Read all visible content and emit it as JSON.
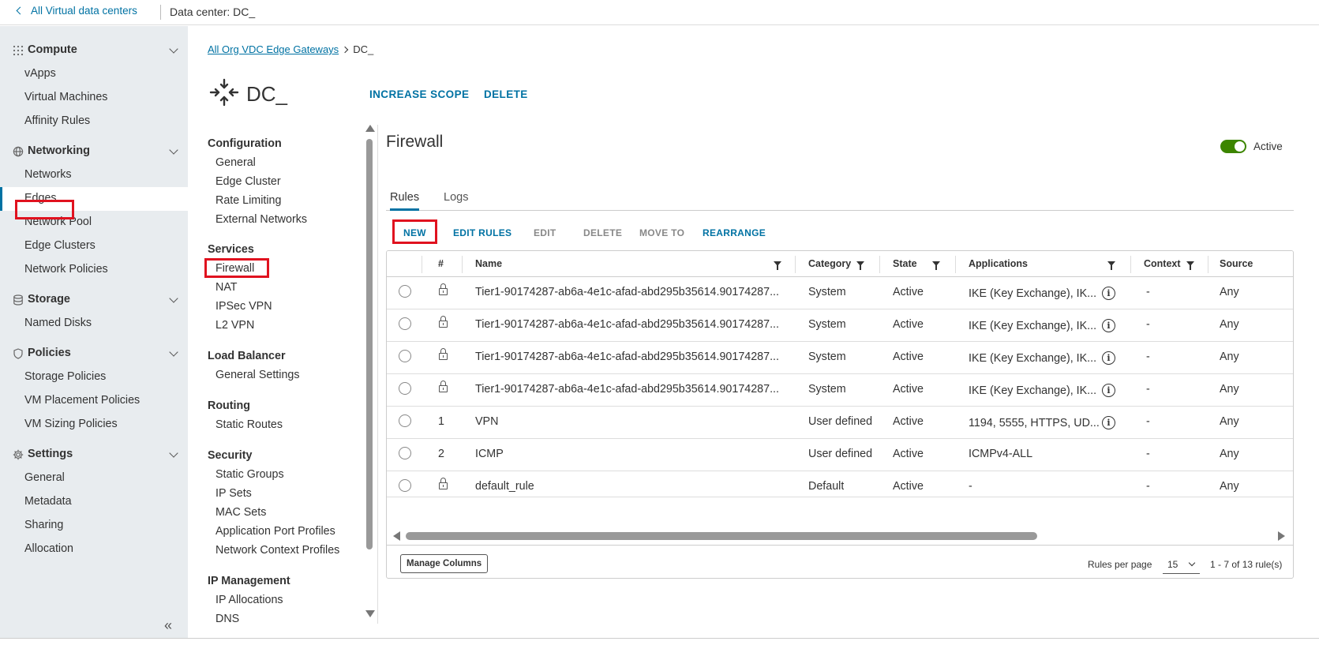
{
  "topbar": {
    "back_label": "All Virtual data centers",
    "dc_label": "Data center:",
    "dc_name": "DC_"
  },
  "sidebar": {
    "compute": {
      "label": "Compute",
      "items": [
        "vApps",
        "Virtual Machines",
        "Affinity Rules"
      ]
    },
    "networking": {
      "label": "Networking",
      "items": [
        "Networks",
        "Edges",
        "Network Pool",
        "Edge Clusters",
        "Network Policies"
      ]
    },
    "storage": {
      "label": "Storage",
      "items": [
        "Named Disks"
      ]
    },
    "policies": {
      "label": "Policies",
      "items": [
        "Storage Policies",
        "VM Placement Policies",
        "VM Sizing Policies"
      ]
    },
    "settings": {
      "label": "Settings",
      "items": [
        "General",
        "Metadata",
        "Sharing",
        "Allocation"
      ]
    },
    "collapse_glyph": "«"
  },
  "breadcrumb": {
    "parent": "All Org VDC Edge Gateways",
    "current": "DC_"
  },
  "gateway": {
    "name": "DC_",
    "actions": [
      "INCREASE SCOPE",
      "DELETE"
    ]
  },
  "leftnav": {
    "configuration": {
      "label": "Configuration",
      "items": [
        "General",
        "Edge Cluster",
        "Rate Limiting",
        "External Networks"
      ]
    },
    "services": {
      "label": "Services",
      "items": [
        "Firewall",
        "NAT",
        "IPSec VPN",
        "L2 VPN"
      ]
    },
    "load_balancer": {
      "label": "Load Balancer",
      "items": [
        "General Settings"
      ]
    },
    "routing": {
      "label": "Routing",
      "items": [
        "Static Routes"
      ]
    },
    "security": {
      "label": "Security",
      "items": [
        "Static Groups",
        "IP Sets",
        "MAC Sets",
        "Application Port Profiles",
        "Network Context Profiles"
      ]
    },
    "ip_management": {
      "label": "IP Management",
      "items": [
        "IP Allocations",
        "DNS"
      ]
    }
  },
  "firewall": {
    "title": "Firewall",
    "status_label": "Active",
    "tabs": [
      "Rules",
      "Logs"
    ],
    "toolbar": [
      "NEW",
      "EDIT RULES",
      "EDIT",
      "DELETE",
      "MOVE TO",
      "REARRANGE"
    ],
    "columns": [
      "#",
      "Name",
      "Category",
      "State",
      "Applications",
      "Context",
      "Source"
    ],
    "rows": [
      {
        "num": "",
        "name": "Tier1-90174287-ab6a-4e1c-afad-abd295b35614.90174287...",
        "category": "System",
        "state": "Active",
        "applications": "IKE (Key Exchange), IK...",
        "context": "-",
        "source": "Any"
      },
      {
        "num": "",
        "name": "Tier1-90174287-ab6a-4e1c-afad-abd295b35614.90174287...",
        "category": "System",
        "state": "Active",
        "applications": "IKE (Key Exchange), IK...",
        "context": "-",
        "source": "Any"
      },
      {
        "num": "",
        "name": "Tier1-90174287-ab6a-4e1c-afad-abd295b35614.90174287...",
        "category": "System",
        "state": "Active",
        "applications": "IKE (Key Exchange), IK...",
        "context": "-",
        "source": "Any"
      },
      {
        "num": "",
        "name": "Tier1-90174287-ab6a-4e1c-afad-abd295b35614.90174287...",
        "category": "System",
        "state": "Active",
        "applications": "IKE (Key Exchange), IK...",
        "context": "-",
        "source": "Any"
      },
      {
        "num": "1",
        "name": "VPN",
        "category": "User defined",
        "state": "Active",
        "applications": "1194, 5555, HTTPS, UD...",
        "context": "-",
        "source": "Any"
      },
      {
        "num": "2",
        "name": "ICMP",
        "category": "User defined",
        "state": "Active",
        "applications": "ICMPv4-ALL",
        "context": "-",
        "source": "Any"
      },
      {
        "num": "",
        "name": "default_rule",
        "category": "Default",
        "state": "Active",
        "applications": "-",
        "context": "-",
        "source": "Any"
      }
    ],
    "footer": {
      "manage_columns": "Manage Columns",
      "rows_per_page_label": "Rules per page",
      "rows_per_page": "15",
      "pagination": "1 - 7 of 13 rule(s)"
    }
  }
}
